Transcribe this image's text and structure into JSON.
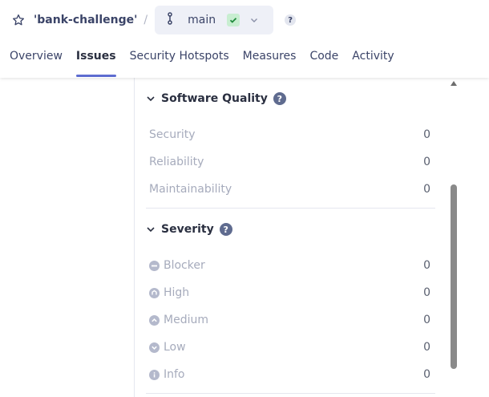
{
  "breadcrumb": {
    "project_name": "'bank-challenge'",
    "separator": "/",
    "branch_name": "main",
    "help": "?"
  },
  "tabs": [
    {
      "label": "Overview"
    },
    {
      "label": "Issues"
    },
    {
      "label": "Security Hotspots"
    },
    {
      "label": "Measures"
    },
    {
      "label": "Code"
    },
    {
      "label": "Activity"
    }
  ],
  "software_quality": {
    "title": "Software Quality",
    "help": "?",
    "items": [
      {
        "label": "Security",
        "count": "0"
      },
      {
        "label": "Reliability",
        "count": "0"
      },
      {
        "label": "Maintainability",
        "count": "0"
      }
    ]
  },
  "severity": {
    "title": "Severity",
    "help": "?",
    "items": [
      {
        "label": "Blocker",
        "count": "0",
        "icon": "blocker-icon"
      },
      {
        "label": "High",
        "count": "0",
        "icon": "high-icon"
      },
      {
        "label": "Medium",
        "count": "0",
        "icon": "medium-icon"
      },
      {
        "label": "Low",
        "count": "0",
        "icon": "low-icon"
      },
      {
        "label": "Info",
        "count": "0",
        "icon": "info-icon"
      }
    ]
  },
  "colors": {
    "accent": "#5d6cd0",
    "status_ok": "#c8eed1",
    "muted_text": "#a6abbc"
  }
}
